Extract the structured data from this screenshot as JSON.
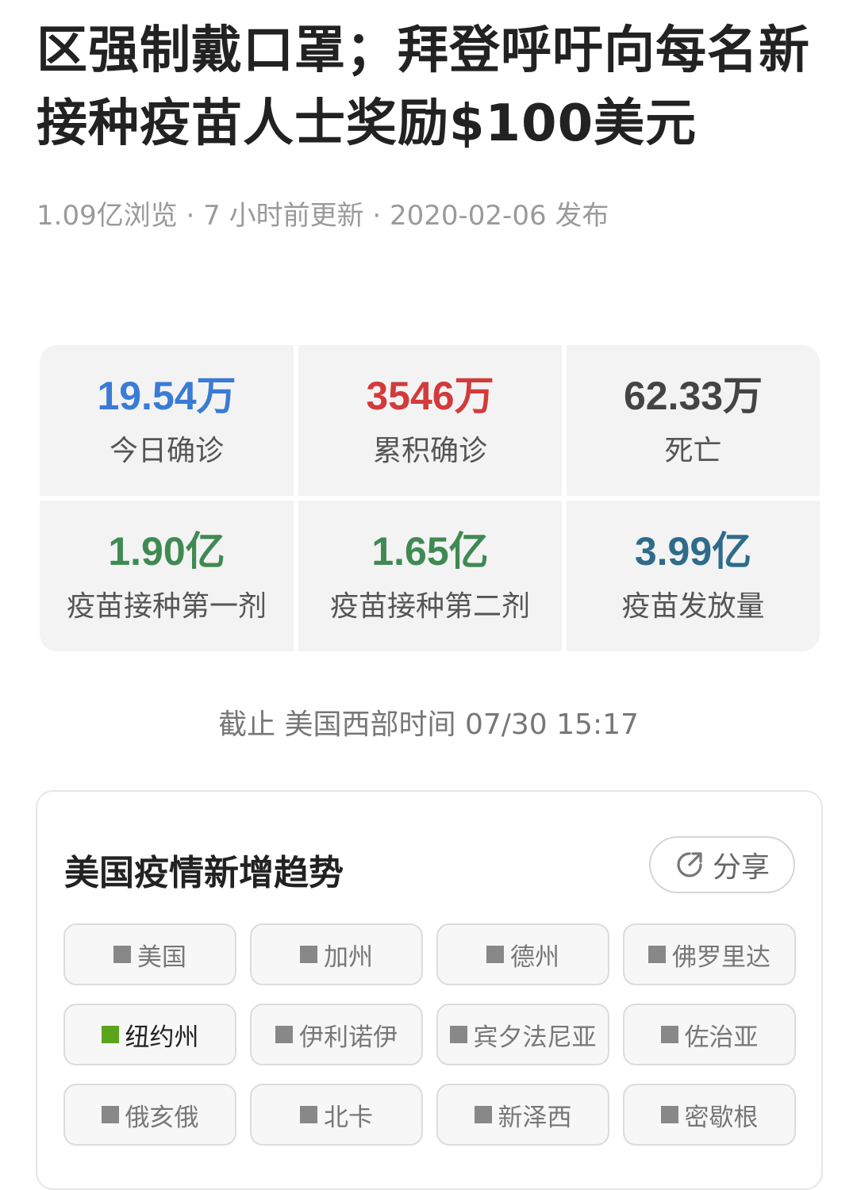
{
  "article": {
    "title_line1": "区强制戴口罩；拜登呼吁向每名新",
    "title_line2": "接种疫苗人士奖励$100美元",
    "meta": "1.09亿浏览 · 7 小时前更新 · 2020-02-06 发布"
  },
  "stats": [
    {
      "value": "19.54万",
      "label": "今日确诊",
      "color": "#3a7bd5"
    },
    {
      "value": "3546万",
      "label": "累积确诊",
      "color": "#d23b3b"
    },
    {
      "value": "62.33万",
      "label": "死亡",
      "color": "#444444"
    },
    {
      "value": "1.90亿",
      "label": "疫苗接种第一剂",
      "color": "#3f8a52"
    },
    {
      "value": "1.65亿",
      "label": "疫苗接种第二剂",
      "color": "#3f8a52"
    },
    {
      "value": "3.99亿",
      "label": "疫苗发放量",
      "color": "#2f6b8a"
    }
  ],
  "as_of": "截止 美国西部时间 07/30 15:17",
  "trend_card": {
    "title": "美国疫情新增趋势",
    "share_label": "分享",
    "chips": [
      {
        "label": "美国",
        "active": false
      },
      {
        "label": "加州",
        "active": false
      },
      {
        "label": "德州",
        "active": false
      },
      {
        "label": "佛罗里达",
        "active": false
      },
      {
        "label": "纽约州",
        "active": true
      },
      {
        "label": "伊利诺伊",
        "active": false
      },
      {
        "label": "宾夕法尼亚",
        "active": false
      },
      {
        "label": "佐治亚",
        "active": false
      },
      {
        "label": "俄亥俄",
        "active": false
      },
      {
        "label": "北卡",
        "active": false
      },
      {
        "label": "新泽西",
        "active": false
      },
      {
        "label": "密歇根",
        "active": false
      }
    ],
    "chip_active_color": "#5aa51c",
    "chip_inactive_color": "#888888"
  }
}
